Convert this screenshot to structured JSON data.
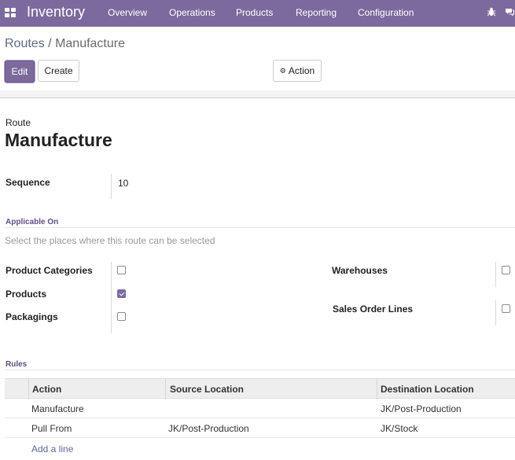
{
  "navbar": {
    "brand": "Inventory",
    "menu": [
      "Overview",
      "Operations",
      "Products",
      "Reporting",
      "Configuration"
    ],
    "right_icons": [
      "bug-icon",
      "chat-icon"
    ],
    "color": "#7c6a9d"
  },
  "breadcrumb": {
    "parent": "Routes",
    "separator": "/",
    "current": "Manufacture"
  },
  "buttons": {
    "edit": "Edit",
    "create": "Create",
    "action": "Action",
    "action_icon": "gear-icon"
  },
  "form": {
    "route_label": "Route",
    "route_name": "Manufacture",
    "sequence_label": "Sequence",
    "sequence_value": "10",
    "applicable_on_title": "Applicable On",
    "applicable_help": "Select the places where this route can be selected",
    "applicable": {
      "product_categories": {
        "label": "Product Categories",
        "checked": false
      },
      "products": {
        "label": "Products",
        "checked": true
      },
      "packagings": {
        "label": "Packagings",
        "checked": false
      },
      "warehouses": {
        "label": "Warehouses",
        "checked": false
      },
      "sales_order_lines": {
        "label": "Sales Order Lines",
        "checked": false
      }
    },
    "rules_title": "Rules"
  },
  "rules": {
    "columns": [
      "Action",
      "Source Location",
      "Destination Location"
    ],
    "rows": [
      {
        "action": "Manufacture",
        "source": "",
        "destination": "JK/Post-Production"
      },
      {
        "action": "Pull From",
        "source": "JK/Post-Production",
        "destination": "JK/Stock"
      }
    ],
    "add_line": "Add a line"
  }
}
